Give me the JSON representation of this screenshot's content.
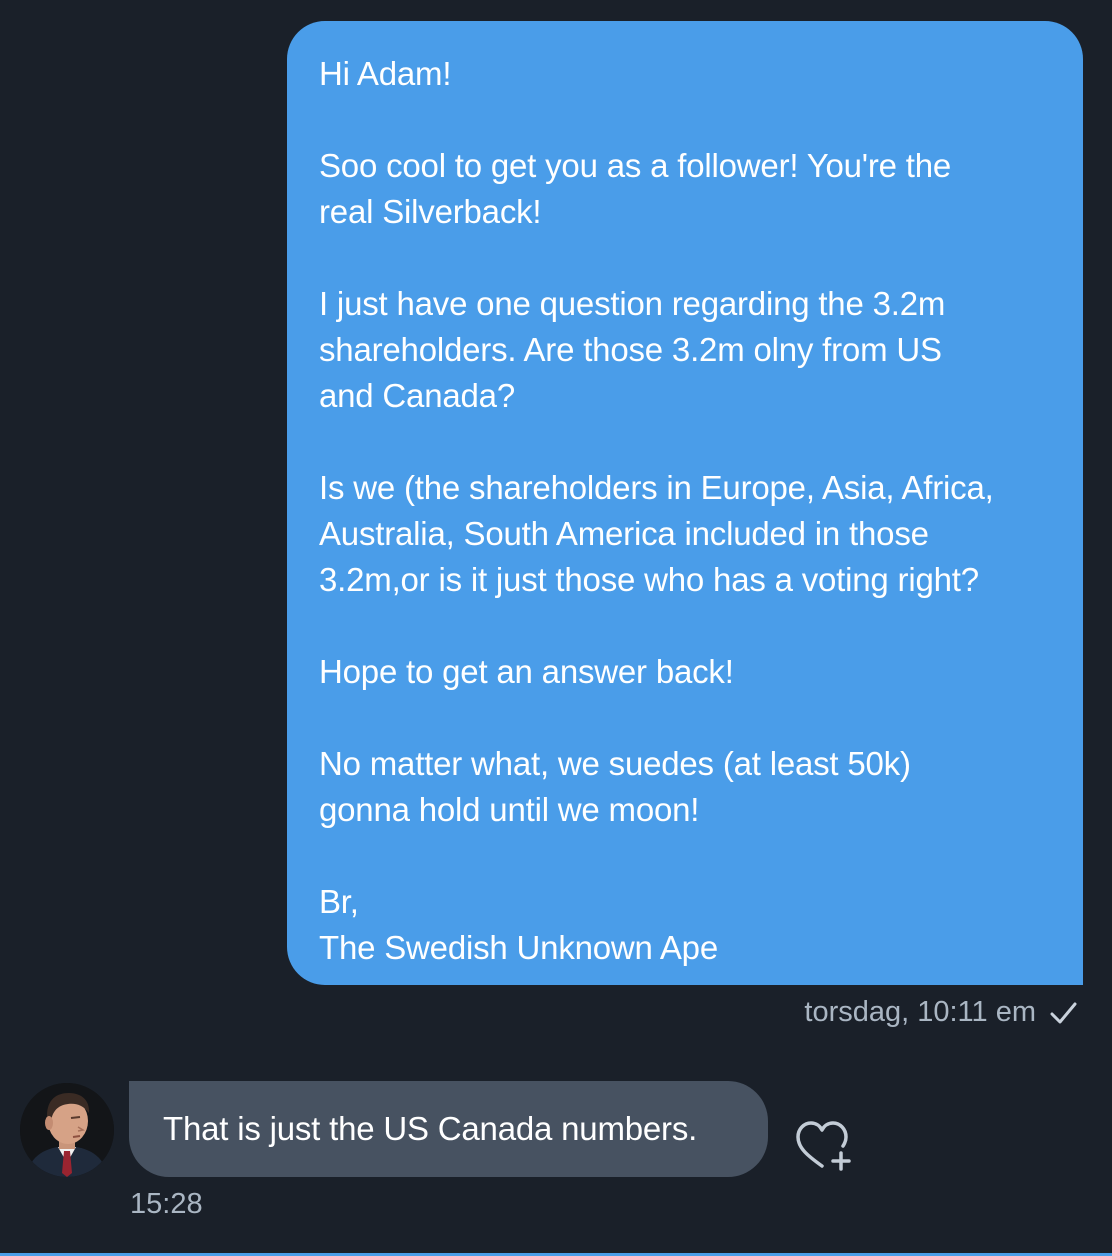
{
  "sent_message": {
    "paragraphs": [
      "Hi Adam!",
      "Soo cool to get you as a follower! You're the\nreal Silverback!",
      "I just have one question regarding the 3.2m\nshareholders. Are those 3.2m olny from US\nand Canada?",
      "Is we (the shareholders in Europe, Asia, Africa,\nAustralia, South America included in those\n3.2m,or is it just those who has a voting right?",
      "Hope to get an answer back!",
      "No matter what, we suedes (at least 50k)\ngonna hold until we moon!",
      "Br,\nThe Swedish Unknown Ape"
    ],
    "timestamp": "torsdag, 10:11 em",
    "status_icon": "check-icon"
  },
  "received_message": {
    "text": "That is just the US Canada numbers.",
    "timestamp": "15:28",
    "avatar_icon": "avatar",
    "reaction_icon": "heart-add-icon"
  },
  "colors": {
    "background": "#1a2029",
    "sent_bubble": "#4a9de9",
    "received_bubble": "#475261",
    "meta_text": "#aab6c3"
  }
}
